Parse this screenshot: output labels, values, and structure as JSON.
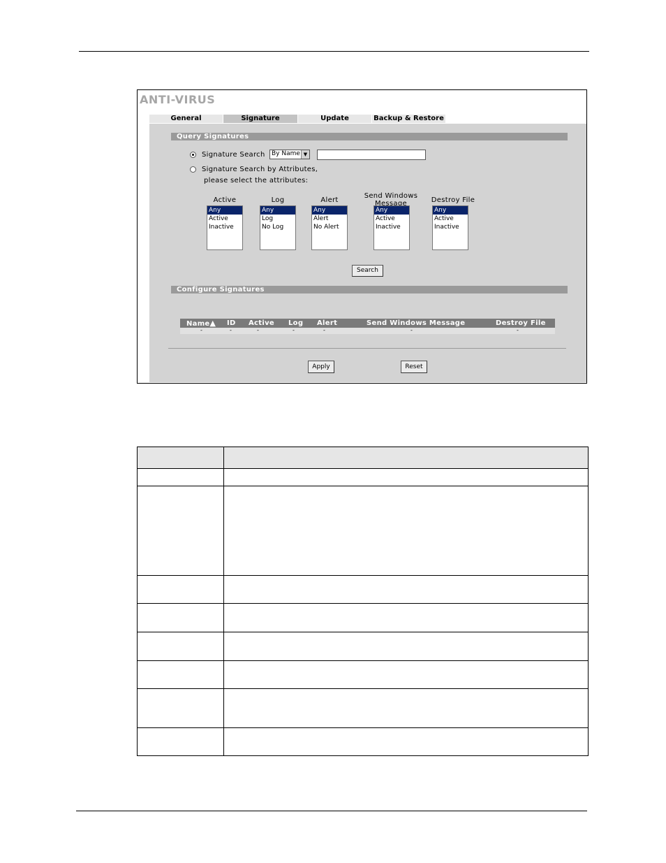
{
  "window": {
    "title": "ANTI-VIRUS",
    "tabs": [
      {
        "label": "General",
        "active": false
      },
      {
        "label": "Signature",
        "active": true
      },
      {
        "label": "Update",
        "active": false
      },
      {
        "label": "Backup & Restore",
        "active": false
      }
    ]
  },
  "query": {
    "section_title": "Query Signatures",
    "radio_search_label": "Signature Search",
    "radio_search_checked": true,
    "search_by_value": "By Name",
    "search_text": "",
    "radio_attr_label": "Signature Search by Attributes,",
    "attr_hint": "please select the attributes:",
    "lists": [
      {
        "title": "Active",
        "options": [
          "Any",
          "Active",
          "Inactive"
        ],
        "selected": "Any"
      },
      {
        "title": "Log",
        "options": [
          "Any",
          "Log",
          "No Log"
        ],
        "selected": "Any"
      },
      {
        "title": "Alert",
        "options": [
          "Any",
          "Alert",
          "No Alert"
        ],
        "selected": "Any"
      },
      {
        "title_line1": "Send Windows",
        "title_line2": "Message",
        "options": [
          "Any",
          "Active",
          "Inactive"
        ],
        "selected": "Any"
      },
      {
        "title": "Destroy File",
        "options": [
          "Any",
          "Active",
          "Inactive"
        ],
        "selected": "Any"
      }
    ],
    "search_button": "Search"
  },
  "configure": {
    "section_title": "Configure Signatures",
    "columns": [
      "Name",
      "ID",
      "Active",
      "Log",
      "Alert",
      "Send Windows Message",
      "Destroy File"
    ],
    "row_placeholder": [
      "-",
      "-",
      "-",
      "-",
      "-",
      "-",
      "-"
    ],
    "apply_button": "Apply",
    "reset_button": "Reset"
  },
  "colors": {
    "panel": "#d3d3d3",
    "section_bar": "#9a9a9a",
    "table_header": "#7a7a7a",
    "selected_option": "#0a246a",
    "title_gray": "#a6a6a6"
  }
}
